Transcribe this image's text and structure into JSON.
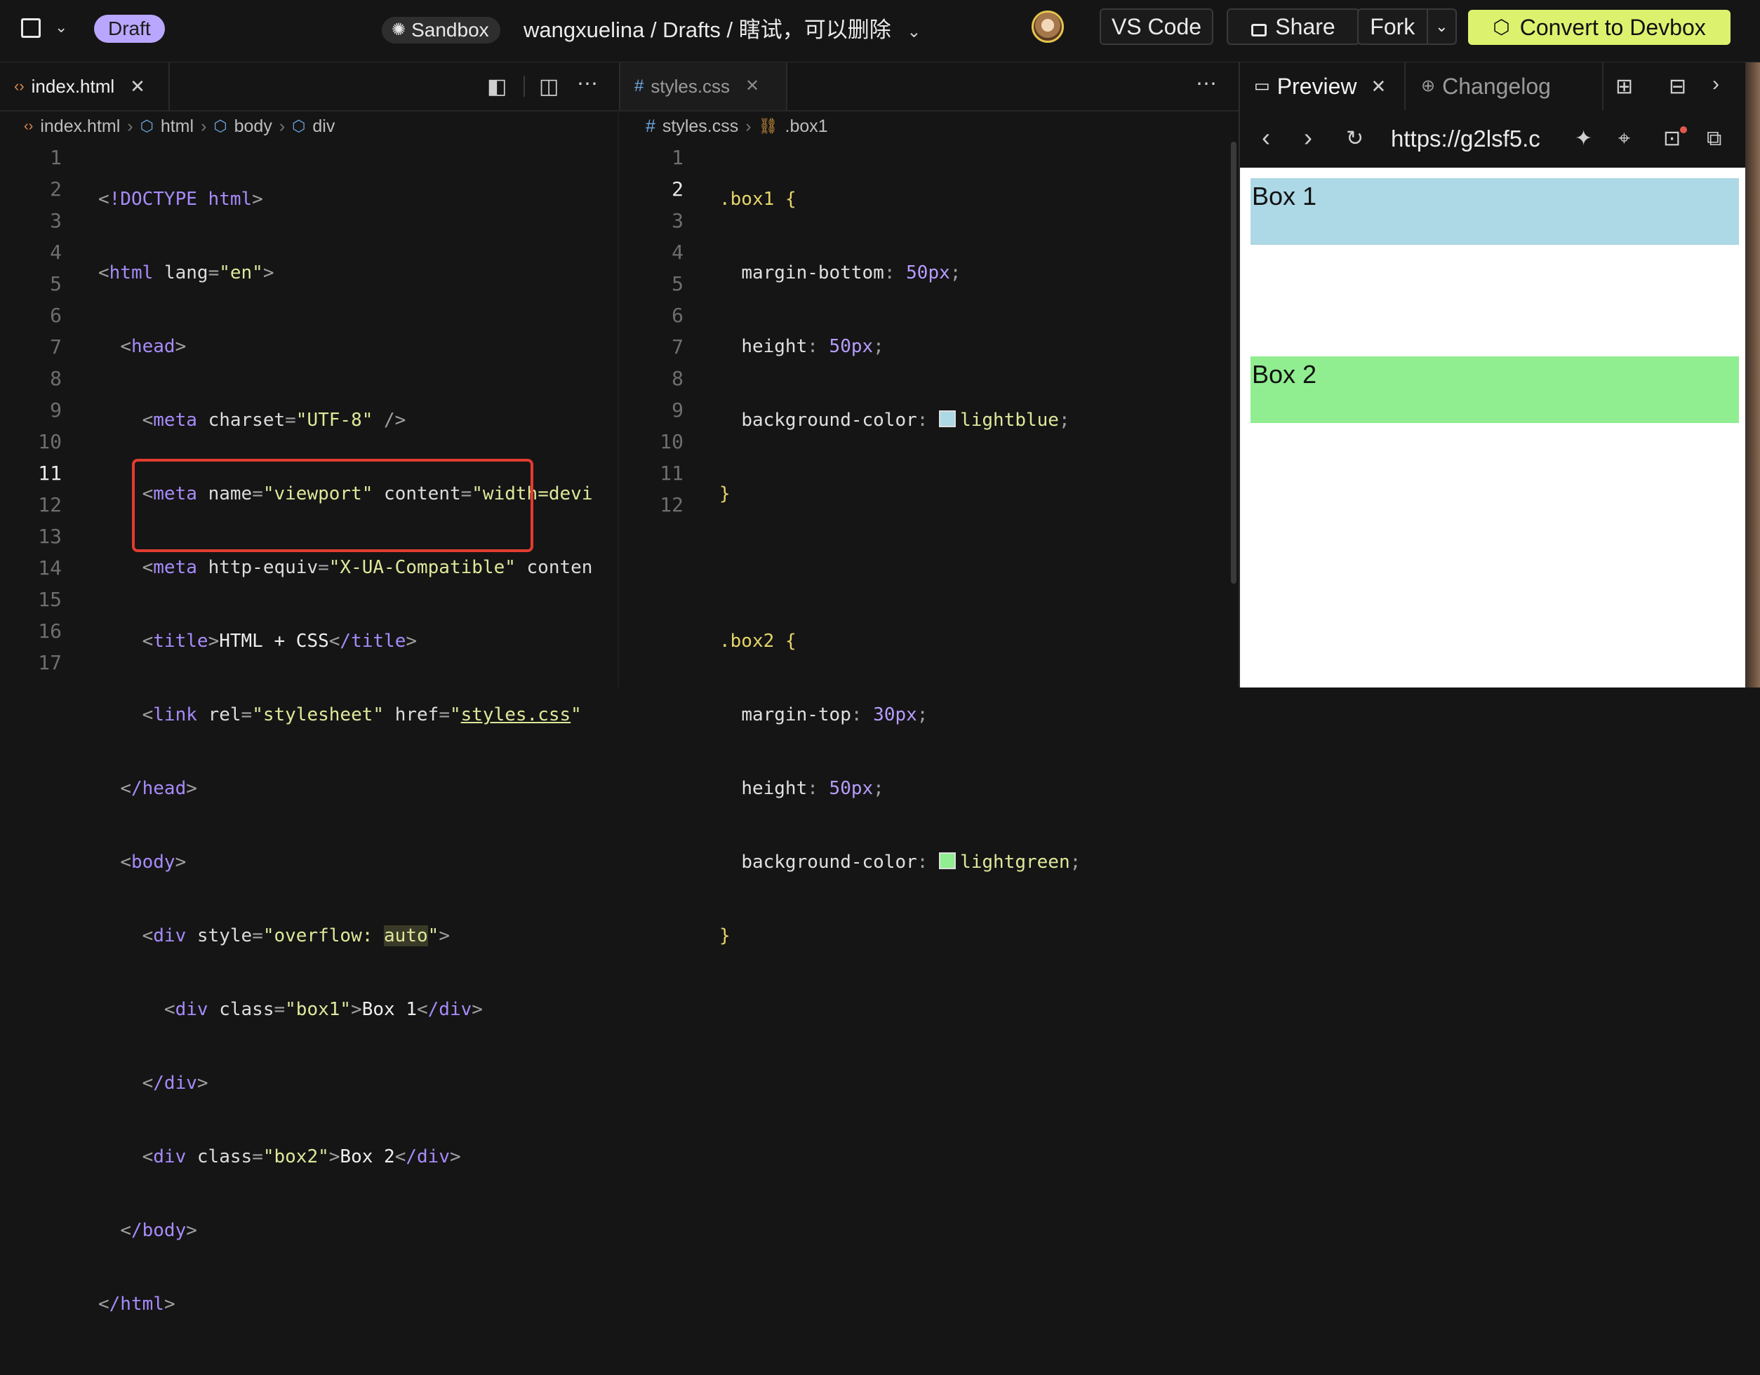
{
  "topbar": {
    "draft_label": "Draft",
    "sandbox_label": "Sandbox",
    "breadcrumb": "wangxuelina / Drafts / 瞎试，可以删除",
    "vscode_label": "VS Code",
    "share_label": "Share",
    "fork_label": "Fork",
    "convert_label": "Convert to Devbox"
  },
  "tabs": {
    "left": {
      "label": "index.html"
    },
    "middle": {
      "label": "styles.css"
    },
    "right": [
      {
        "label": "Preview"
      },
      {
        "label": "Changelog"
      }
    ]
  },
  "html_breadcrumb": [
    "index.html",
    "html",
    "body",
    "div"
  ],
  "css_breadcrumb": [
    "styles.css",
    ".box1"
  ],
  "html_line_numbers": [
    "1",
    "2",
    "3",
    "4",
    "5",
    "6",
    "7",
    "8",
    "9",
    "10",
    "11",
    "12",
    "13",
    "14",
    "15",
    "16",
    "17"
  ],
  "css_line_numbers": [
    "1",
    "2",
    "3",
    "4",
    "5",
    "6",
    "7",
    "8",
    "9",
    "10",
    "11",
    "12"
  ],
  "active_line_html": "11",
  "active_line_css": "2",
  "html_code": {
    "l1_doctype": "!DOCTYPE html",
    "l2_tag": "html",
    "l2_attr": "lang",
    "l2_val": "\"en\"",
    "l3_tag": "head",
    "l4_tag": "meta",
    "l4_attr": "charset",
    "l4_val": "\"UTF-8\"",
    "l4_end": " />",
    "l5_tag": "meta",
    "l5_attr1": "name",
    "l5_val1": "\"viewport\"",
    "l5_attr2": "content",
    "l5_val2": "\"width=devi",
    "l6_tag": "meta",
    "l6_attr1": "http-equiv",
    "l6_val1": "\"X-UA-Compatible\"",
    "l6_attr2": "conten",
    "l7_tag": "title",
    "l7_text": "HTML + CSS",
    "l7_close": "/title",
    "l8_tag": "link",
    "l8_attr1": "rel",
    "l8_val1": "\"stylesheet\"",
    "l8_attr2": "href",
    "l8_val2_q": "\"",
    "l8_val2": "styles.css",
    "l8_val2_end": "\"",
    "l9_close": "/head",
    "l10_tag": "body",
    "l11_tag": "div",
    "l11_attr": "style",
    "l11_val_a": "\"overflow: ",
    "l11_val_b": "auto",
    "l11_val_c": "\"",
    "l12_tag": "div",
    "l12_attr": "class",
    "l12_val": "\"box1\"",
    "l12_text": "Box 1",
    "l12_close": "/div",
    "l13_close": "/div",
    "l14_tag": "div",
    "l14_attr": "class",
    "l14_val": "\"box2\"",
    "l14_text": "Box 2",
    "l14_close": "/div",
    "l15_close": "/body",
    "l16_close": "/html"
  },
  "css_code": {
    "sel1": ".box1",
    "p1": "margin-bottom",
    "v1": "50",
    "u1": "px",
    "p2": "height",
    "v2": "50",
    "u2": "px",
    "p3": "background-color",
    "c3": "lightblue",
    "sel2": ".box2",
    "p4": "margin-top",
    "v4": "30",
    "u4": "px",
    "p5": "height",
    "v5": "50",
    "u5": "px",
    "p6": "background-color",
    "c6": "lightgreen",
    "swatch_blue": "#add8e6",
    "swatch_green": "#90ee90"
  },
  "preview": {
    "url": "https://g2lsf5.c",
    "box1_label": "Box 1",
    "box2_label": "Box 2"
  },
  "icons": {
    "window": "square-icon",
    "sandbox": "sandbox-icon",
    "lock": "lock-icon",
    "cube": "cube-icon",
    "globe": "globe-icon"
  }
}
